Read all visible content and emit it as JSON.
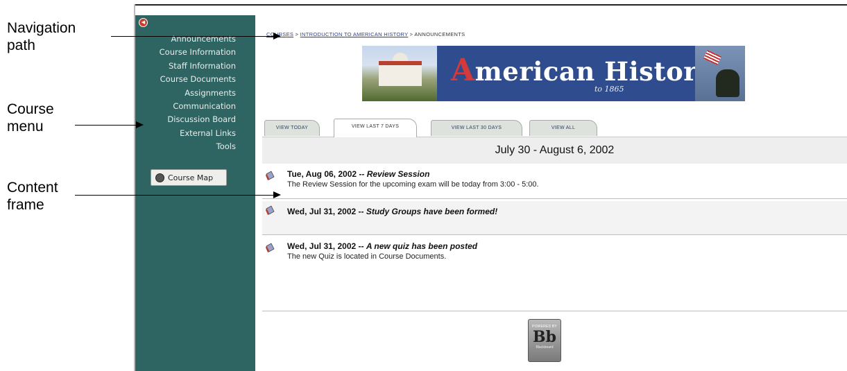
{
  "annotations": [
    {
      "text_line1": "Navigation",
      "text_line2": "path"
    },
    {
      "text_line1": "Course",
      "text_line2": "menu"
    },
    {
      "text_line1": "Content",
      "text_line2": "frame"
    }
  ],
  "sidebar": {
    "menu_items": [
      {
        "label": "Announcements"
      },
      {
        "label": "Course Information"
      },
      {
        "label": "Staff Information"
      },
      {
        "label": "Course Documents"
      },
      {
        "label": "Assignments"
      },
      {
        "label": "Communication"
      },
      {
        "label": "Discussion Board"
      },
      {
        "label": "External Links"
      },
      {
        "label": "Tools"
      }
    ],
    "course_map_label": "Course Map"
  },
  "breadcrumb": {
    "root": "COURSES",
    "sep": ">",
    "course": "INTRODUCTION TO AMERICAN HISTORY",
    "current": "ANNOUNCEMENTS"
  },
  "banner": {
    "initial": "A",
    "title_rest": "merican History",
    "subtitle": "to 1865"
  },
  "tabs": [
    {
      "label": "VIEW TODAY"
    },
    {
      "label": "VIEW LAST 7 DAYS"
    },
    {
      "label": "VIEW LAST 30 DAYS"
    },
    {
      "label": "VIEW ALL"
    }
  ],
  "date_range": "July 30 - August 6, 2002",
  "announcements": [
    {
      "date": "Tue, Aug 06, 2002 -- ",
      "title": "Review Session",
      "body": "The Review Session for the upcoming exam will be today from 3:00 - 5:00."
    },
    {
      "date": "Wed, Jul 31, 2002 -- ",
      "title": "Study Groups have been formed!",
      "body": ""
    },
    {
      "date": "Wed, Jul 31, 2002 -- ",
      "title": "A new quiz has been posted",
      "body": "The new Quiz is located in Course Documents."
    }
  ],
  "footer_logo": {
    "top": "POWERED BY",
    "mark": "Bb",
    "bottom": "Blackboard"
  },
  "colors": {
    "sidebar": "#2e6462",
    "banner": "#2f4d8e",
    "link": "#2b3f8a"
  }
}
